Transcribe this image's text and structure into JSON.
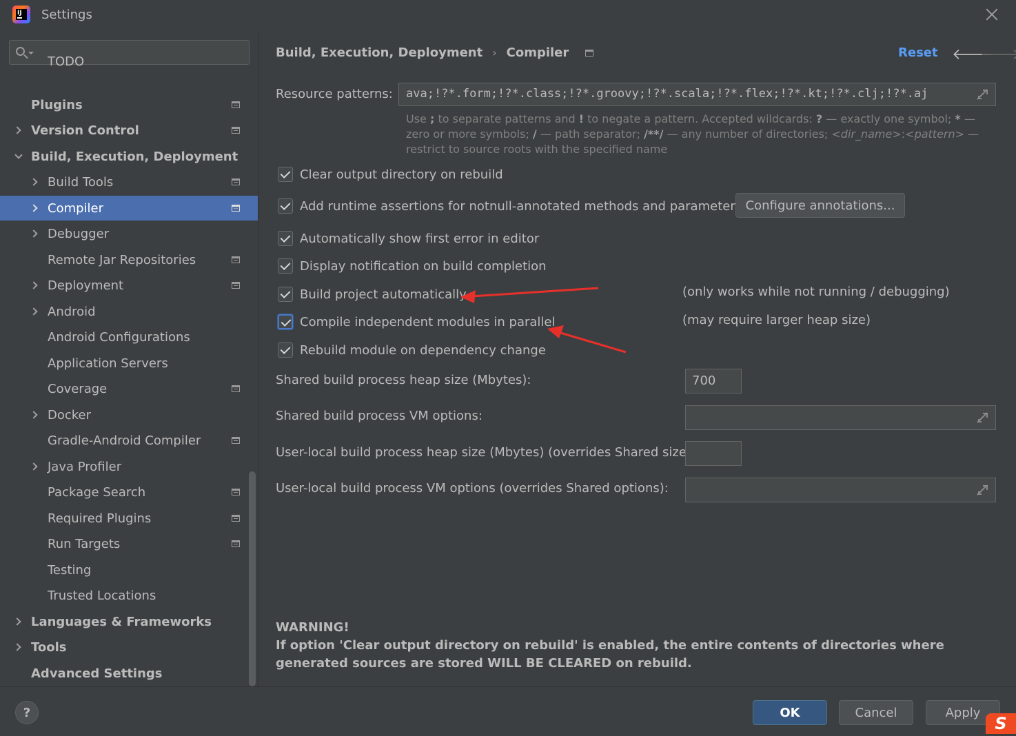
{
  "window": {
    "title": "Settings",
    "logo_text": "IJ"
  },
  "search": {
    "placeholder": "",
    "value": ""
  },
  "sidebar": {
    "items": [
      {
        "label": "TODO"
      },
      {
        "label": "Plugins"
      },
      {
        "label": "Version Control"
      },
      {
        "label": "Build, Execution, Deployment"
      },
      {
        "label": "Build Tools"
      },
      {
        "label": "Compiler"
      },
      {
        "label": "Debugger"
      },
      {
        "label": "Remote Jar Repositories"
      },
      {
        "label": "Deployment"
      },
      {
        "label": "Android"
      },
      {
        "label": "Android Configurations"
      },
      {
        "label": "Application Servers"
      },
      {
        "label": "Coverage"
      },
      {
        "label": "Docker"
      },
      {
        "label": "Gradle-Android Compiler"
      },
      {
        "label": "Java Profiler"
      },
      {
        "label": "Package Search"
      },
      {
        "label": "Required Plugins"
      },
      {
        "label": "Run Targets"
      },
      {
        "label": "Testing"
      },
      {
        "label": "Trusted Locations"
      },
      {
        "label": "Languages & Frameworks"
      },
      {
        "label": "Tools"
      },
      {
        "label": "Advanced Settings"
      }
    ]
  },
  "header": {
    "breadcrumb_parent": "Build, Execution, Deployment",
    "breadcrumb_sep": "›",
    "breadcrumb_current": "Compiler",
    "reset_label": "Reset",
    "back_glyph": "🡐",
    "forward_glyph": "🡒"
  },
  "compiler": {
    "resource_patterns_label": "Resource patterns:",
    "resource_patterns_value": "ava;!?*.form;!?*.class;!?*.groovy;!?*.scala;!?*.flex;!?*.kt;!?*.clj;!?*.aj",
    "hint_part1": "Use ",
    "hint_semicolon": ";",
    "hint_part2": " to separate patterns and ",
    "hint_bang": "!",
    "hint_part3": " to negate a pattern. Accepted wildcards: ",
    "hint_q": "?",
    "hint_part4": " — exactly one symbol; ",
    "hint_star": "*",
    "hint_part5": " — zero or more symbols; ",
    "hint_slash": "/",
    "hint_part6": " — path separator; ",
    "hint_dstar": "/**/",
    "hint_part7": " — any number of directories; ",
    "hint_dirname": "<dir_name>",
    "hint_colon": ":",
    "hint_pattern": "<pattern>",
    "hint_part8": " — restrict to source roots with the specified name",
    "checkboxes": [
      {
        "label": "Clear output directory on rebuild",
        "checked": true
      },
      {
        "label": "Add runtime assertions for notnull-annotated methods and parameters",
        "checked": true
      },
      {
        "label": "Automatically show first error in editor",
        "checked": true
      },
      {
        "label": "Display notification on build completion",
        "checked": true
      },
      {
        "label": "Build project automatically",
        "checked": true
      },
      {
        "label": "Compile independent modules in parallel",
        "checked": true
      },
      {
        "label": "Rebuild module on dependency change",
        "checked": true
      }
    ],
    "configure_annotations_label": "Configure annotations...",
    "note_build_auto": "(only works while not running / debugging)",
    "note_parallel": "(may require larger heap size)",
    "shared_heap_label": "Shared build process heap size (Mbytes):",
    "shared_heap_value": "700",
    "shared_vm_label": "Shared build process VM options:",
    "shared_vm_value": "",
    "user_heap_label": "User-local build process heap size (Mbytes) (overrides Shared size):",
    "user_heap_value": "",
    "user_vm_label": "User-local build process VM options (overrides Shared options):",
    "user_vm_value": "",
    "warning_title": "WARNING!",
    "warning_text": "If option 'Clear output directory on rebuild' is enabled, the entire contents of directories where generated sources are stored WILL BE CLEARED on rebuild."
  },
  "footer": {
    "help_label": "?",
    "ok_label": "OK",
    "cancel_label": "Cancel",
    "apply_label": "Apply",
    "ime_logo": "S"
  },
  "colors": {
    "background": "#3c3f41",
    "selection": "#4b6eaf",
    "link": "#589df6",
    "primary_button": "#365880",
    "annotation_arrow": "#e8302a"
  }
}
